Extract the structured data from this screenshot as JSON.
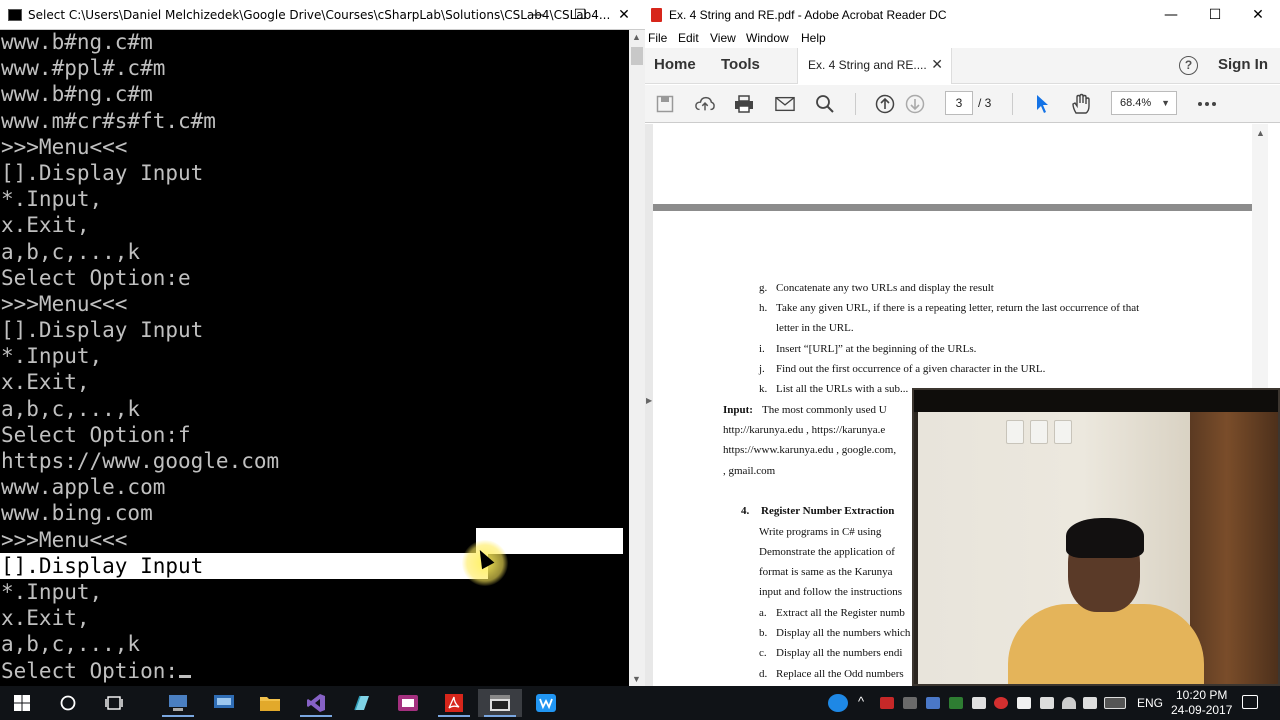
{
  "console": {
    "title": "Select C:\\Users\\Daniel Melchizedek\\Google Drive\\Courses\\cSharpLab\\Solutions\\CSLab4\\CSLab4...",
    "lines": [
      "www.b#ng.c#m",
      "www.#ppl#.c#m",
      "www.b#ng.c#m",
      "www.m#cr#s#ft.c#m",
      ">>>Menu<<<",
      "[].Display Input",
      "*.Input,",
      "x.Exit,",
      "a,b,c,...,k",
      "Select Option:e",
      ">>>Menu<<<",
      "[].Display Input",
      "*.Input,",
      "x.Exit,",
      "a,b,c,...,k",
      "Select Option:f",
      "https://www.google.com",
      "www.apple.com",
      "www.bing.com",
      ">>>Menu<<<",
      "[].Display Input",
      "*.Input,",
      "x.Exit,",
      "a,b,c,...,k",
      "Select Option:"
    ]
  },
  "acrobat": {
    "title": "Ex. 4 String and RE.pdf - Adobe Acrobat Reader DC",
    "menu": [
      "File",
      "Edit",
      "View",
      "Window",
      "Help"
    ],
    "nav": {
      "home": "Home",
      "tools": "Tools"
    },
    "tab_label": "Ex. 4 String and RE....",
    "sign_in": "Sign In",
    "page_current": "3",
    "page_total": "/  3",
    "zoom": "68.4%",
    "doc": {
      "items": [
        {
          "marker": "g.",
          "text": "Concatenate any two URLs and display the result"
        },
        {
          "marker": "h.",
          "text": "Take any given URL, if there is a repeating letter, return the last occurrence of that"
        },
        {
          "marker": "",
          "text": "letter in the URL."
        },
        {
          "marker": "i.",
          "text": "Insert “[URL]” at the beginning of the URLs."
        },
        {
          "marker": "j.",
          "text": "Find out the first occurrence of  a given character in the URL."
        },
        {
          "marker": "k.",
          "text": "List all the URLs with a sub..."
        }
      ],
      "input_label": "Input:",
      "input_text": "The most commonly used U",
      "urls_1": "http://karunya.edu    ,  https://karunya.e",
      "urls_2": "https://www.karunya.edu , google.com,",
      "urls_3": ", gmail.com",
      "section_num": "4.",
      "section_title": "Register Number Extraction",
      "para_1": "Write programs in C# using",
      "para_2": "Demonstrate the application of",
      "para_3": "format is same as the Karunya",
      "para_4": "input and follow the instructions",
      "sub_items": [
        {
          "marker": "a.",
          "text": "Extract all the Register numb"
        },
        {
          "marker": "b.",
          "text": "Display all the numbers which"
        },
        {
          "marker": "c.",
          "text": "Display all the numbers endi"
        },
        {
          "marker": "d.",
          "text": "Replace all the Odd numbers"
        }
      ]
    }
  },
  "taskbar": {
    "language": "ENG",
    "time": "10:20 PM",
    "date": "24-09-2017"
  }
}
